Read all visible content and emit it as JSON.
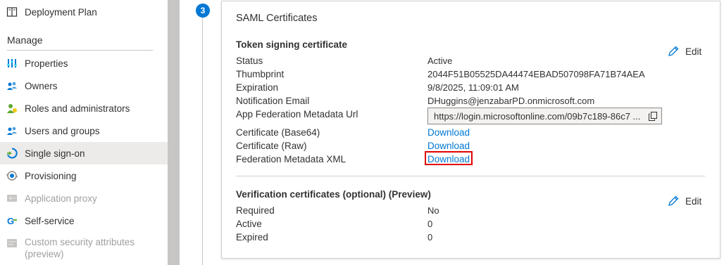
{
  "sidebar": {
    "top_item": {
      "label": "Deployment Plan",
      "icon": "book-icon"
    },
    "section_title": "Manage",
    "items": [
      {
        "label": "Properties",
        "icon": "properties-icon"
      },
      {
        "label": "Owners",
        "icon": "owners-icon"
      },
      {
        "label": "Roles and administrators",
        "icon": "roles-icon"
      },
      {
        "label": "Users and groups",
        "icon": "users-groups-icon"
      },
      {
        "label": "Single sign-on",
        "icon": "single-sign-on-icon",
        "selected": true
      },
      {
        "label": "Provisioning",
        "icon": "provisioning-icon"
      },
      {
        "label": "Application proxy",
        "icon": "application-proxy-icon",
        "disabled": true
      },
      {
        "label": "Self-service",
        "icon": "self-service-icon"
      },
      {
        "label": "Custom security attributes (preview)",
        "label_line1": "Custom security attributes",
        "label_line2": "(preview)",
        "icon": "custom-attributes-icon",
        "disabled": true
      }
    ]
  },
  "step": {
    "number": "3"
  },
  "card": {
    "title": "SAML Certificates",
    "token": {
      "title": "Token signing certificate",
      "edit_label": "Edit",
      "status_label": "Status",
      "status_value": "Active",
      "thumbprint_label": "Thumbprint",
      "thumbprint_value": "2044F51B05525DA44474EBAD507098FA71B74AEA",
      "expiration_label": "Expiration",
      "expiration_value": "9/8/2025, 11:09:01 AM",
      "email_label": "Notification Email",
      "email_value": "DHuggins@jenzabarPD.onmicrosoft.com",
      "metadata_url_label": "App Federation Metadata Url",
      "metadata_url_value": "https://login.microsoftonline.com/09b7c189-86c7 ...",
      "cert_base64_label": "Certificate (Base64)",
      "cert_base64_link": "Download",
      "cert_raw_label": "Certificate (Raw)",
      "cert_raw_link": "Download",
      "fed_xml_label": "Federation Metadata XML",
      "fed_xml_link": "Download"
    },
    "verification": {
      "title": "Verification certificates (optional) (Preview)",
      "edit_label": "Edit",
      "required_label": "Required",
      "required_value": "No",
      "active_label": "Active",
      "active_value": "0",
      "expired_label": "Expired",
      "expired_value": "0"
    }
  },
  "colors": {
    "accent": "#0078d4",
    "highlight": "#e00000",
    "selected_bg": "#edebe9"
  }
}
